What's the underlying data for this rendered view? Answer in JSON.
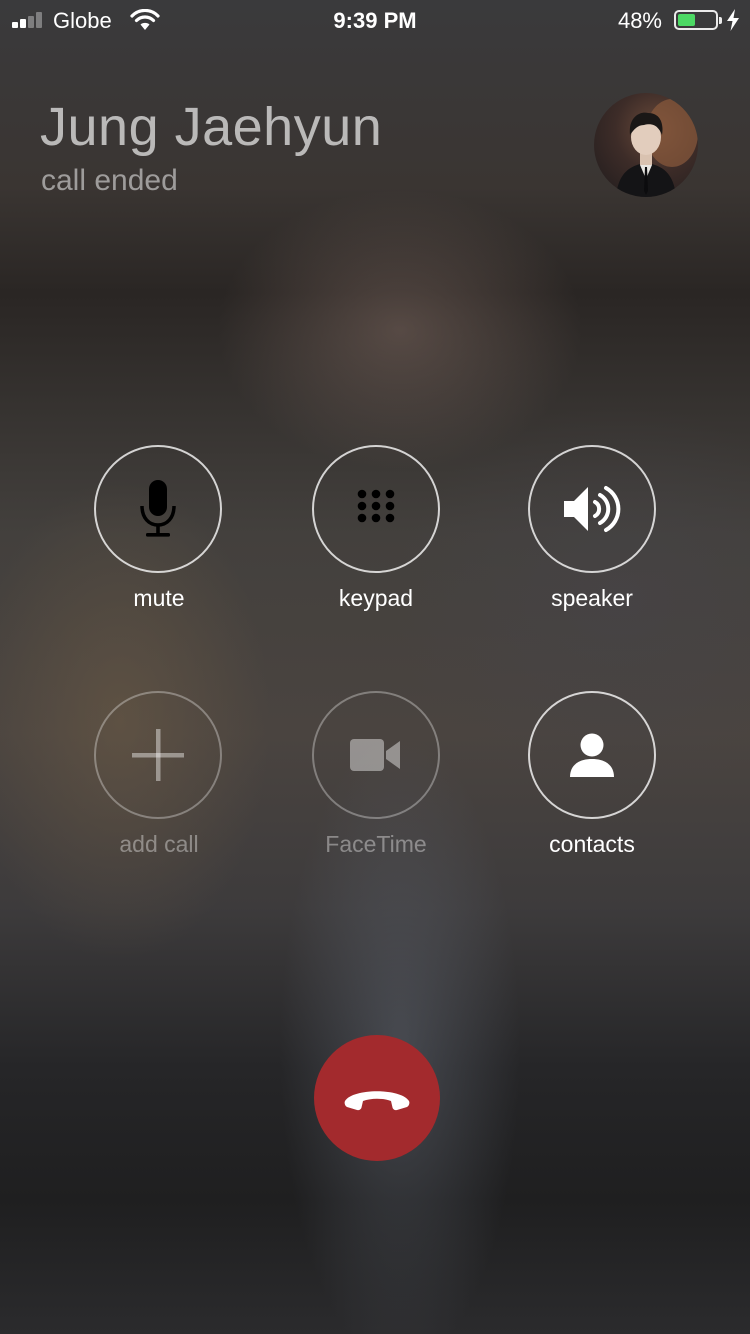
{
  "status_bar": {
    "carrier": "Globe",
    "time": "9:39 PM",
    "battery_percent": "48%",
    "battery_level": 0.48,
    "signal_bars": 2,
    "charging": true
  },
  "caller": {
    "name": "Jung Jaehyun",
    "status": "call ended"
  },
  "controls": {
    "mute": {
      "label": "mute",
      "icon": "microphone-icon",
      "enabled": true
    },
    "keypad": {
      "label": "keypad",
      "icon": "keypad-icon",
      "enabled": true
    },
    "speaker": {
      "label": "speaker",
      "icon": "speaker-icon",
      "enabled": true
    },
    "add_call": {
      "label": "add call",
      "icon": "plus-icon",
      "enabled": false
    },
    "facetime": {
      "label": "FaceTime",
      "icon": "video-camera-icon",
      "enabled": false
    },
    "contacts": {
      "label": "contacts",
      "icon": "person-icon",
      "enabled": true
    }
  },
  "end_call": {
    "icon": "phone-hangup-icon",
    "color": "#a32a2d"
  },
  "colors": {
    "battery_fill": "#4cd964"
  }
}
